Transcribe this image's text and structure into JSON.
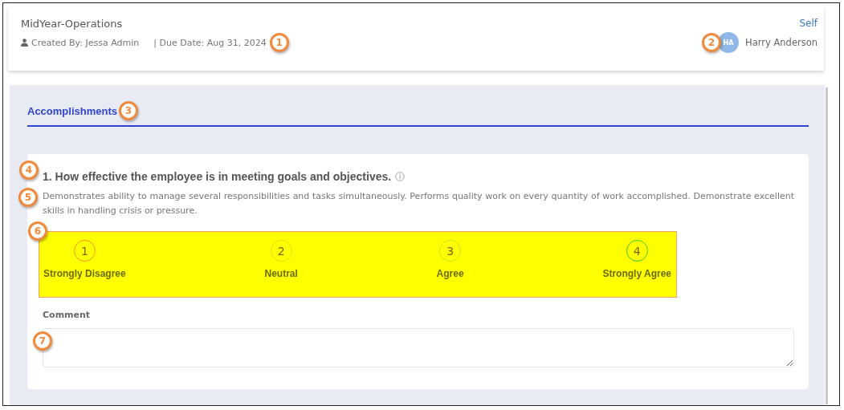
{
  "header": {
    "title": "MidYear-Operations",
    "created_by": "Created By: Jessa Admin",
    "due_date": "| Due Date: Aug 31, 2024",
    "callout": "1",
    "role": "Self",
    "avatar_initials": "HA",
    "user_name": "Harry Anderson",
    "user_callout": "2"
  },
  "tabs": [
    {
      "label": "Accomplishments",
      "selected": true,
      "callout": "3"
    }
  ],
  "question": {
    "title": "1. How effective the employee is in meeting goals and objectives.",
    "title_callout": "4",
    "description": "Demonstrates ability to manage several responsibilities and tasks simultaneously. Performs quality work on every quantity of work accomplished. Demonstrate excellent skills in handling crisis or pressure.",
    "description_callout": "5",
    "scale_callout": "6",
    "options": [
      {
        "number": "1",
        "label": "Strongly Disagree",
        "color": "#f0902a"
      },
      {
        "number": "2",
        "label": "Neutral",
        "color": "#f2d21a"
      },
      {
        "number": "3",
        "label": "Agree",
        "color": "#c8e020"
      },
      {
        "number": "4",
        "label": "Strongly Agree",
        "color": "#3cc22c"
      }
    ],
    "comment_label": "Comment",
    "comment_callout": "7"
  }
}
